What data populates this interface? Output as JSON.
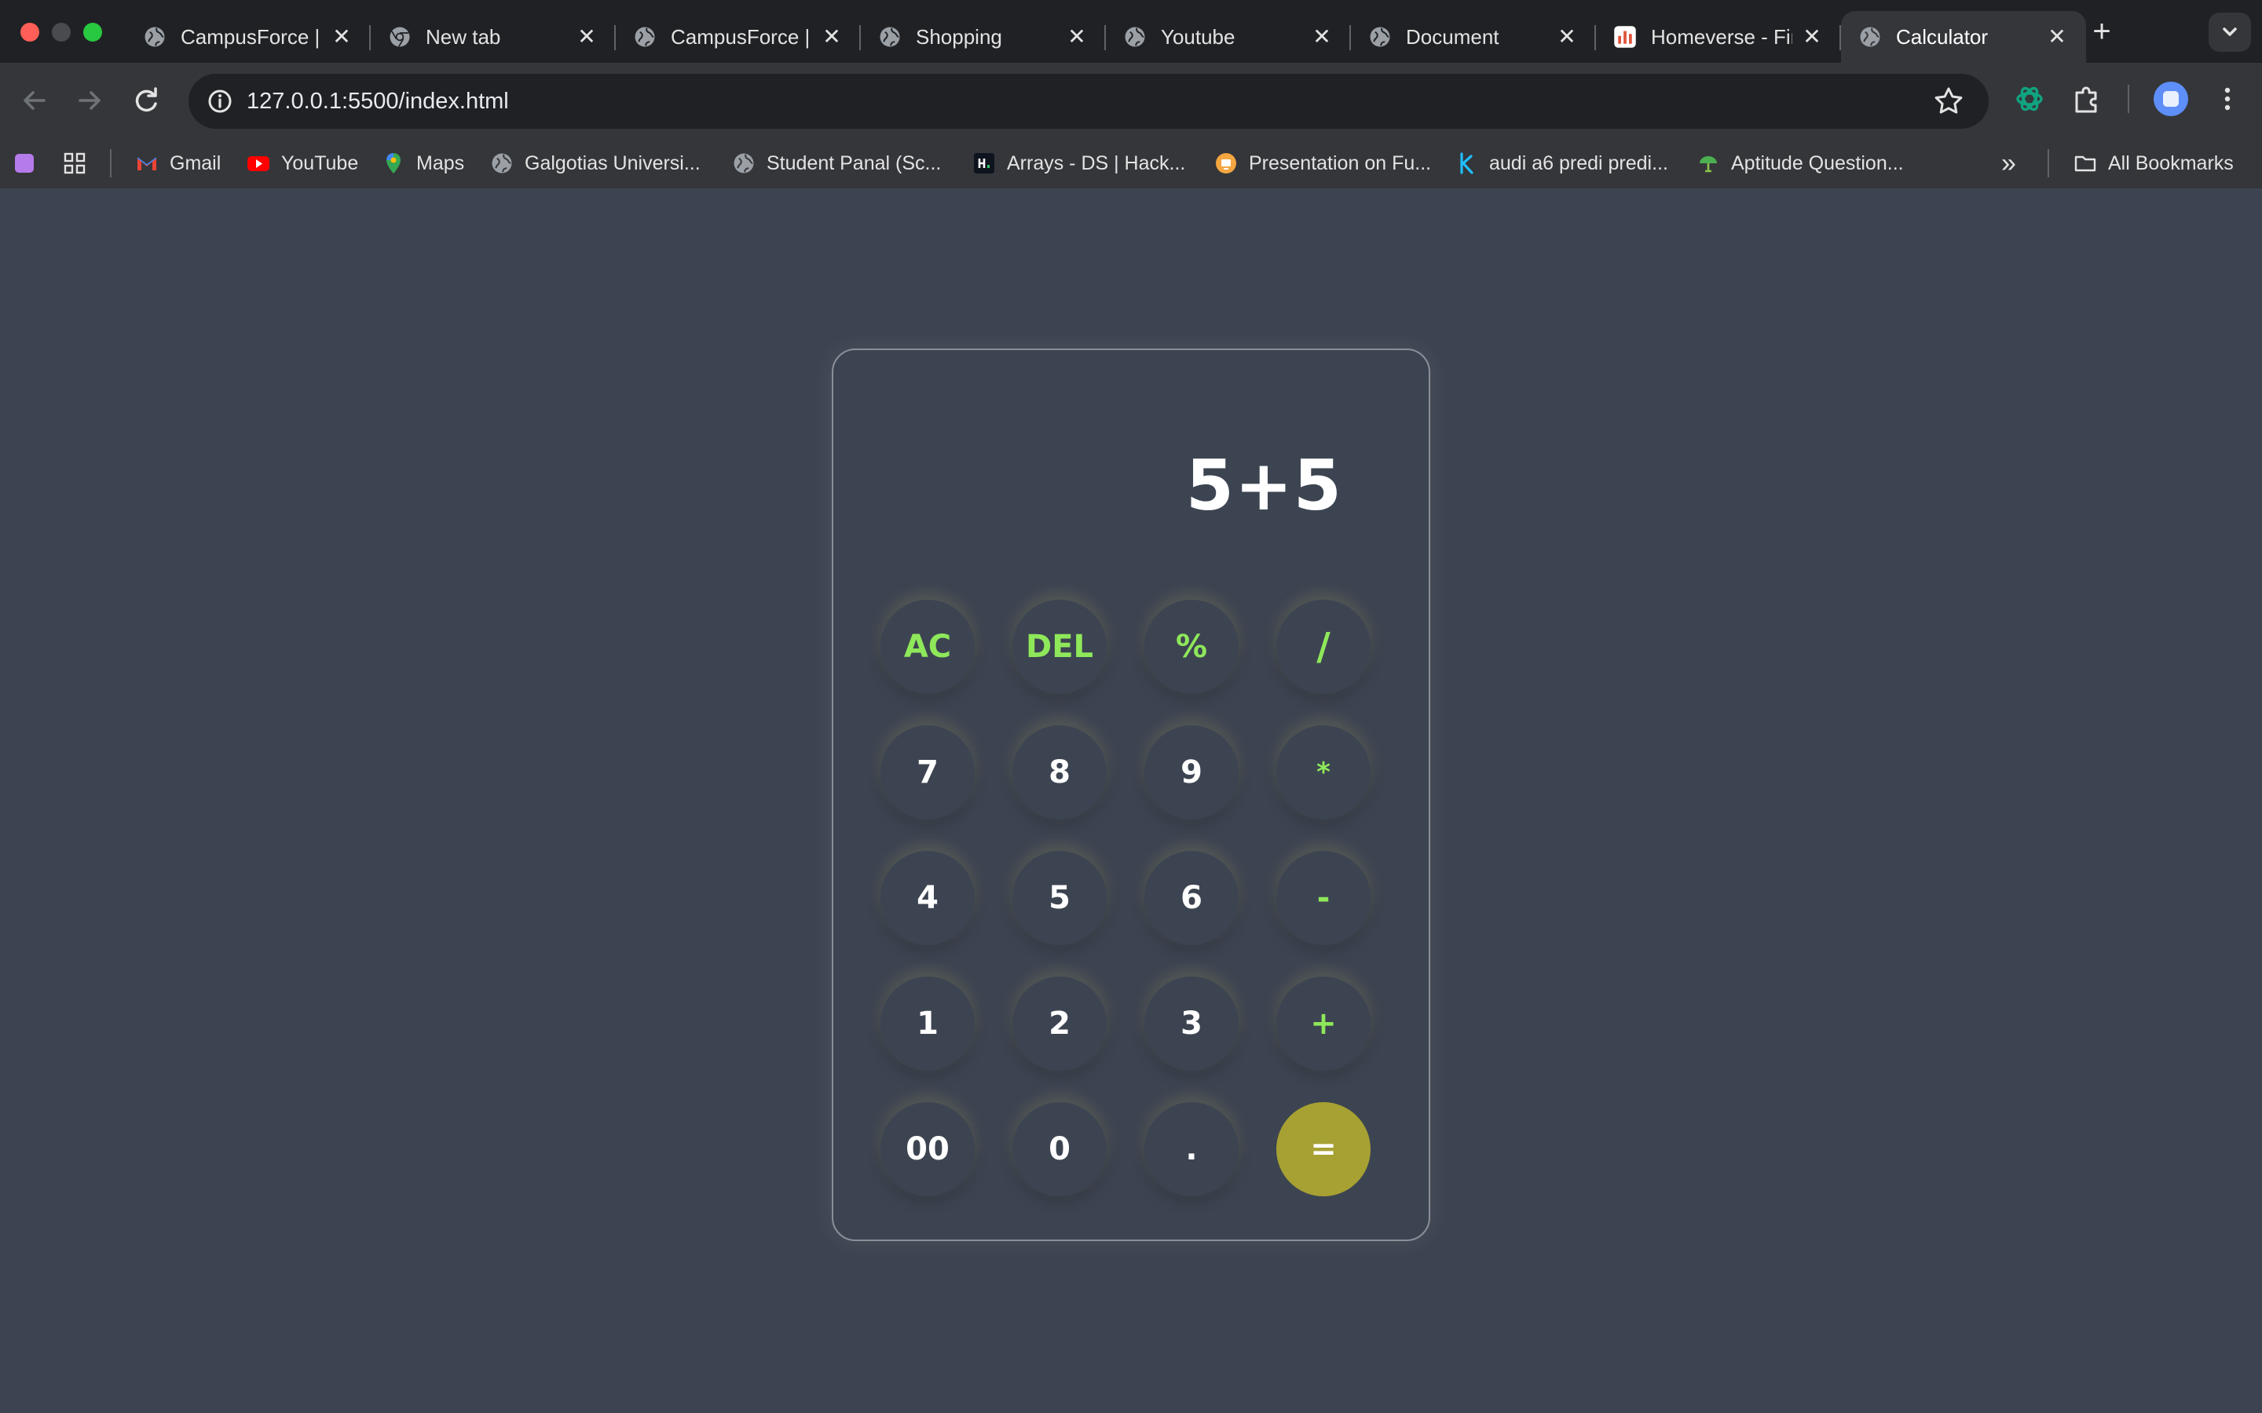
{
  "window": {
    "tabs": [
      {
        "title": "CampusForce | Cam",
        "icon": "globe-icon",
        "active": false
      },
      {
        "title": "New tab",
        "icon": "chrome-icon",
        "active": false
      },
      {
        "title": "CampusForce | Cam",
        "icon": "globe-icon",
        "active": false
      },
      {
        "title": "Shopping",
        "icon": "globe-icon",
        "active": false
      },
      {
        "title": "Youtube",
        "icon": "globe-icon",
        "active": false
      },
      {
        "title": "Document",
        "icon": "globe-icon",
        "active": false
      },
      {
        "title": "Homeverse - Find",
        "icon": "homeverse-icon",
        "active": false
      },
      {
        "title": "Calculator",
        "icon": "globe-icon",
        "active": true
      }
    ],
    "tab_close_glyph": "✕",
    "new_tab_glyph": "+"
  },
  "toolbar": {
    "url": "127.0.0.1:5500/index.html"
  },
  "bookmarks": {
    "items": [
      {
        "label": "Gmail",
        "icon": "gmail-icon"
      },
      {
        "label": "YouTube",
        "icon": "youtube-icon"
      },
      {
        "label": "Maps",
        "icon": "maps-icon"
      },
      {
        "label": "Galgotias Universi...",
        "icon": "globe-icon"
      },
      {
        "label": "Student Panal (Sc...",
        "icon": "globe-icon"
      },
      {
        "label": "Arrays - DS | Hack...",
        "icon": "hackerrank-icon"
      },
      {
        "label": "Presentation on Fu...",
        "icon": "presentation-icon"
      },
      {
        "label": "audi a6 predi predi...",
        "icon": "kaggle-icon"
      },
      {
        "label": "Aptitude Question...",
        "icon": "aptitude-icon"
      }
    ],
    "more_glyph": "»",
    "all_bookmarks": "All Bookmarks"
  },
  "calculator": {
    "display": "5+5",
    "keys": [
      [
        "AC",
        "DEL",
        "%",
        "/"
      ],
      [
        "7",
        "8",
        "9",
        "*"
      ],
      [
        "4",
        "5",
        "6",
        "-"
      ],
      [
        "1",
        "2",
        "3",
        "+"
      ],
      [
        "00",
        "0",
        ".",
        "="
      ]
    ],
    "colors": {
      "background": "#3d4451",
      "operator": "#8ee85a",
      "equals": "#a6a132",
      "digit": "#ffffff"
    }
  }
}
